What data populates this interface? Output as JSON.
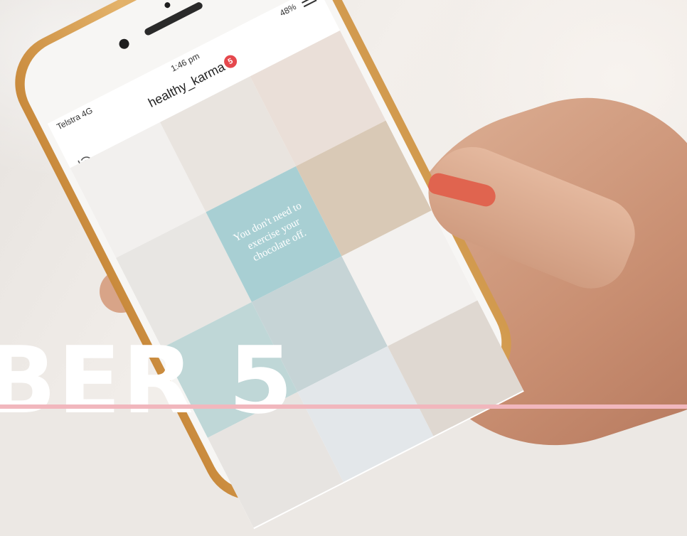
{
  "status": {
    "carrier": "Telstra 4G",
    "time": "1:46 pm",
    "battery": "48%"
  },
  "profile": {
    "username": "healthy_karma",
    "notification_count": "5"
  },
  "tiles": [
    {
      "name": "flowers-photo",
      "color": "#f2f0ee"
    },
    {
      "name": "grapefruit-photo",
      "color": "#e9e4df"
    },
    {
      "name": "bath-photo",
      "color": "#eadfd8"
    },
    {
      "name": "woman-dog-photo",
      "color": "#e8e6e3"
    },
    {
      "name": "quote-card",
      "color": "#a8cfd3"
    },
    {
      "name": "vineyard-photo",
      "color": "#d9c9b6"
    },
    {
      "name": "picnic-photo",
      "color": "#bfd7d7"
    },
    {
      "name": "beach-photo",
      "color": "#c6d4d6"
    },
    {
      "name": "smiling-woman-photo",
      "color": "#f3f1ef"
    },
    {
      "name": "woman-phone-photo",
      "color": "#e7e4e1"
    },
    {
      "name": "gym-photo",
      "color": "#e3e7ea"
    },
    {
      "name": "salad-photo",
      "color": "#dfd8d1"
    }
  ],
  "quote_text": "You don't need to exercise your chocolate off.",
  "overlay": {
    "big_text": "BER 5"
  }
}
